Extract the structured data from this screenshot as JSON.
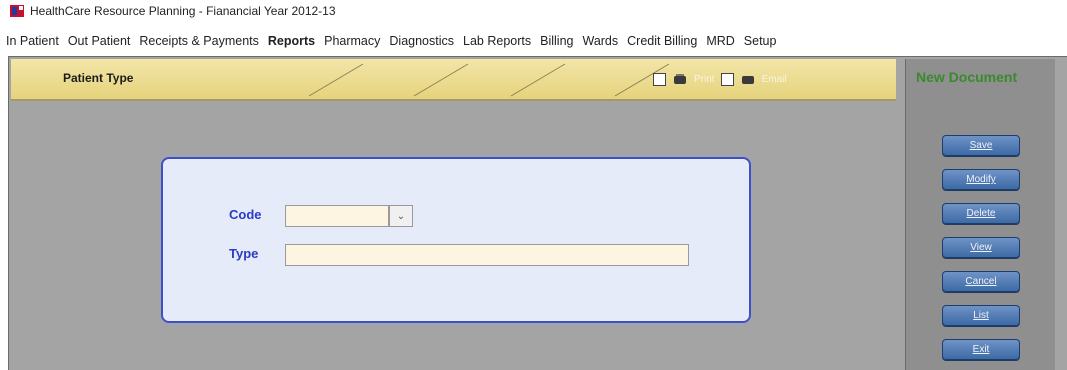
{
  "window": {
    "title": "HealthCare Resource Planning - Fianancial Year 2012-13"
  },
  "menu": [
    {
      "label": "In Patient"
    },
    {
      "label": "Out Patient"
    },
    {
      "label": "Receipts & Payments"
    },
    {
      "label": "Reports",
      "active": true
    },
    {
      "label": "Pharmacy"
    },
    {
      "label": "Diagnostics"
    },
    {
      "label": "Lab Reports"
    },
    {
      "label": "Billing"
    },
    {
      "label": "Wards"
    },
    {
      "label": "Credit Billing"
    },
    {
      "label": "MRD"
    },
    {
      "label": "Setup"
    }
  ],
  "header": {
    "title": "Patient Type",
    "print_label": "Print",
    "email_label": "Email"
  },
  "sidebar": {
    "status": "New Document",
    "buttons": [
      {
        "label": "Save"
      },
      {
        "label": "Modify"
      },
      {
        "label": "Delete"
      },
      {
        "label": "View"
      },
      {
        "label": "Cancel"
      },
      {
        "label": "List"
      },
      {
        "label": "Exit"
      }
    ]
  },
  "form": {
    "code_label": "Code",
    "code_value": "",
    "type_label": "Type",
    "type_value": ""
  },
  "colors": {
    "header_strip": "#e6d37c",
    "workspace": "#a4a4a4",
    "form_border": "#3f4fcb",
    "form_label": "#2c3bc5",
    "input_bg": "#fdf5e2",
    "status_text": "#3a8a2c",
    "button": "#3d6aa5"
  }
}
